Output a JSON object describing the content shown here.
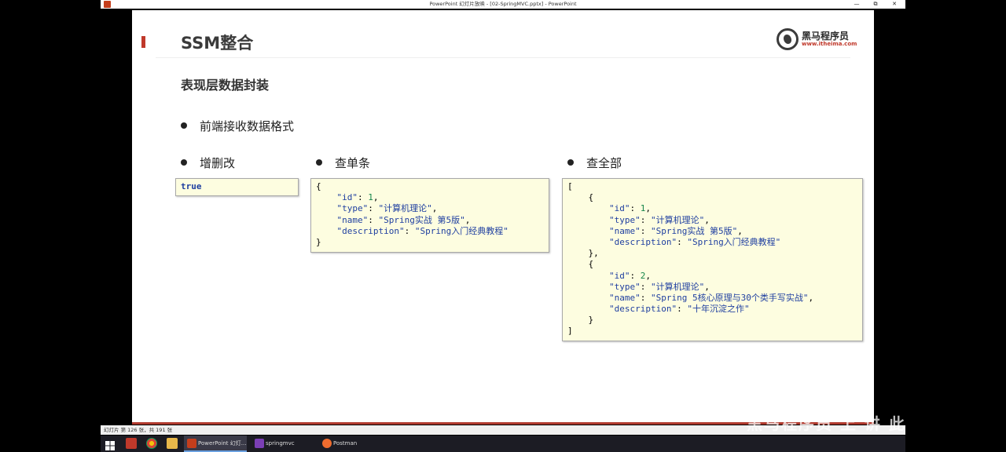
{
  "window": {
    "title": "PowerPoint 幻灯片放映 - [02-SpringMVC.pptx] - PowerPoint",
    "minimize": "—",
    "maximize": "⧉",
    "close": "✕"
  },
  "slide": {
    "title": "SSM整合",
    "logo_brand": "黑马程序员",
    "logo_url": "www.itheima.com",
    "subtitle": "表现层数据封装",
    "bullet_main": "前端接收数据格式",
    "bullet_cud": "增删改",
    "bullet_single": "查单条",
    "bullet_all": "查全部",
    "code_cud": [
      "true"
    ],
    "code_single": [
      "{",
      "    \"id\": 1,",
      "    \"type\": \"计算机理论\",",
      "    \"name\": \"Spring实战 第5版\",",
      "    \"description\": \"Spring入门经典教程\"",
      "}"
    ],
    "code_all": [
      "[",
      "    {",
      "        \"id\": 1,",
      "        \"type\": \"计算机理论\",",
      "        \"name\": \"Spring实战 第5版\",",
      "        \"description\": \"Spring入门经典教程\"",
      "    },",
      "    {",
      "        \"id\": 2,",
      "        \"type\": \"计算机理论\",",
      "        \"name\": \"Spring 5核心原理与30个类手写实战\",",
      "        \"description\": \"十年沉淀之作\"",
      "    }",
      "]"
    ]
  },
  "statusbar": {
    "text": "幻灯片 第 126 张，共 191 张"
  },
  "taskbar": {
    "items": [
      {
        "label": "PowerPoint 幻灯...",
        "icon": "powerpoint-icon",
        "color": "#c43e1c"
      },
      {
        "label": "springmvc",
        "icon": "intellij-icon",
        "color": "#7b3fb5"
      },
      {
        "label": "Postman",
        "icon": "postman-icon",
        "color": "#ef6c2f"
      }
    ]
  },
  "watermark": "黑马程序员 上 讲 此",
  "colors": {
    "accent": "#c0392b",
    "code_bg": "#fdfde0",
    "json_key": "#1f3fa0",
    "json_number": "#16864a"
  }
}
